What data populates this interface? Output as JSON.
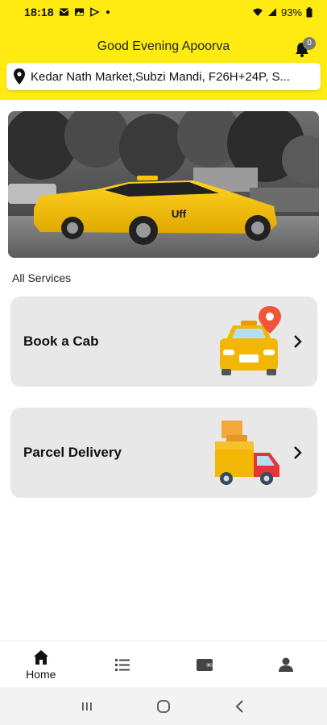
{
  "status_bar": {
    "time": "18:18",
    "battery": "93%"
  },
  "header": {
    "greeting": "Good Evening Apoorva",
    "notification_count": "0",
    "address": "Kedar Nath Market,Subzi Mandi, F26H+24P, S..."
  },
  "banner": {
    "car_brand_text": "Uff"
  },
  "services": {
    "title": "All Services",
    "items": [
      {
        "label": "Book a Cab",
        "icon": "taxi-with-location-pin-icon"
      },
      {
        "label": "Parcel Delivery",
        "icon": "delivery-truck-icon"
      }
    ]
  },
  "bottom_nav": {
    "items": [
      {
        "label": "Home",
        "icon": "home-icon",
        "active": true
      },
      {
        "label": "",
        "icon": "list-icon"
      },
      {
        "label": "",
        "icon": "wallet-icon"
      },
      {
        "label": "",
        "icon": "profile-icon"
      }
    ]
  },
  "colors": {
    "accent": "#FFEB12",
    "card": "#e8e8e8"
  }
}
